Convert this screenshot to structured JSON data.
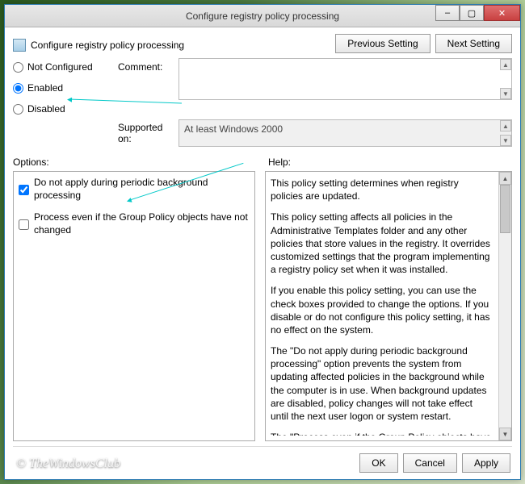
{
  "window": {
    "title": "Configure registry policy processing",
    "minimize": "–",
    "maximize": "▢",
    "close": "✕"
  },
  "header": {
    "policy_name": "Configure registry policy processing"
  },
  "nav": {
    "prev": "Previous Setting",
    "next": "Next Setting"
  },
  "state": {
    "not_configured": "Not Configured",
    "enabled": "Enabled",
    "disabled": "Disabled",
    "selected": "enabled"
  },
  "labels": {
    "comment": "Comment:",
    "supported": "Supported on:",
    "options": "Options:",
    "help": "Help:"
  },
  "supported_text": "At least Windows 2000",
  "options": {
    "chk1": {
      "label": "Do not apply during periodic background processing",
      "checked": true
    },
    "chk2": {
      "label": "Process even if the Group Policy objects have not changed",
      "checked": false
    }
  },
  "help": {
    "p1": "This policy setting determines when registry policies are updated.",
    "p2": "This policy setting affects all policies in the Administrative Templates folder and any other policies that store values in the registry. It overrides customized settings that the program implementing a registry policy set when it was installed.",
    "p3": "If you enable this policy setting, you can use the check boxes provided to change the options. If you disable or do not configure this policy setting, it has no effect on the system.",
    "p4": "The \"Do not apply during periodic background processing\" option prevents the system from updating affected policies in the background while the computer is in use. When background updates are disabled, policy changes will not take effect until the next user logon or system restart.",
    "p5": "The \"Process even if the Group Policy objects have not changed\" option updates and reapplies the policies even if the policies have not changed. Many policy implementations specify that"
  },
  "buttons": {
    "ok": "OK",
    "cancel": "Cancel",
    "apply": "Apply"
  },
  "watermark": "© TheWindowsClub"
}
